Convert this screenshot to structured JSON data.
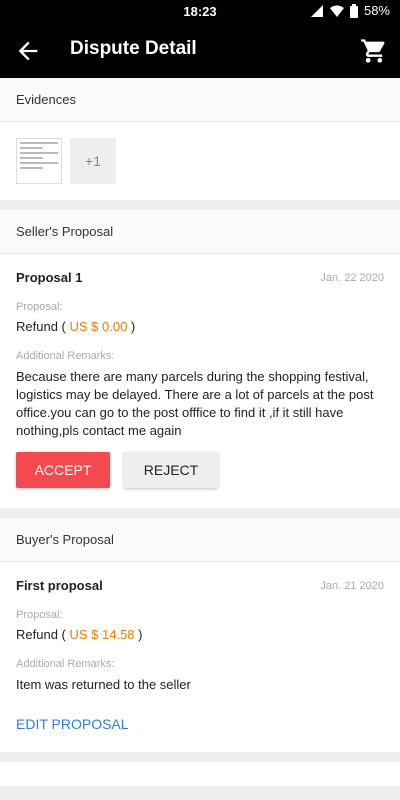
{
  "status": {
    "time": "18:23",
    "battery": "58%"
  },
  "appbar": {
    "title": "Dispute Detail"
  },
  "evidences": {
    "header": "Evidences",
    "more_count": "+1"
  },
  "seller": {
    "header": "Seller's Proposal",
    "title": "Proposal 1",
    "date": "Jan. 22 2020",
    "proposal_label": "Proposal:",
    "refund_prefix": "Refund ( ",
    "amount": "US $ 0.00",
    "refund_suffix": " )",
    "remarks_label": "Additional Remarks:",
    "remarks": "Because there are many parcels during the shopping festival, logistics may be delayed. There are a lot of parcels at the post office.you can go to the post offfice to find it ,if it still have nothing,pls contact me again",
    "accept_label": "ACCEPT",
    "reject_label": "REJECT"
  },
  "buyer": {
    "header": "Buyer's Proposal",
    "title": "First proposal",
    "date": "Jan. 21 2020",
    "proposal_label": "Proposal:",
    "refund_prefix": "Refund ( ",
    "amount": "US $ 14.58",
    "refund_suffix": " )",
    "remarks_label": "Additional Remarks:",
    "remarks": "Item was returned to the seller",
    "edit_label": "EDIT PROPOSAL"
  }
}
